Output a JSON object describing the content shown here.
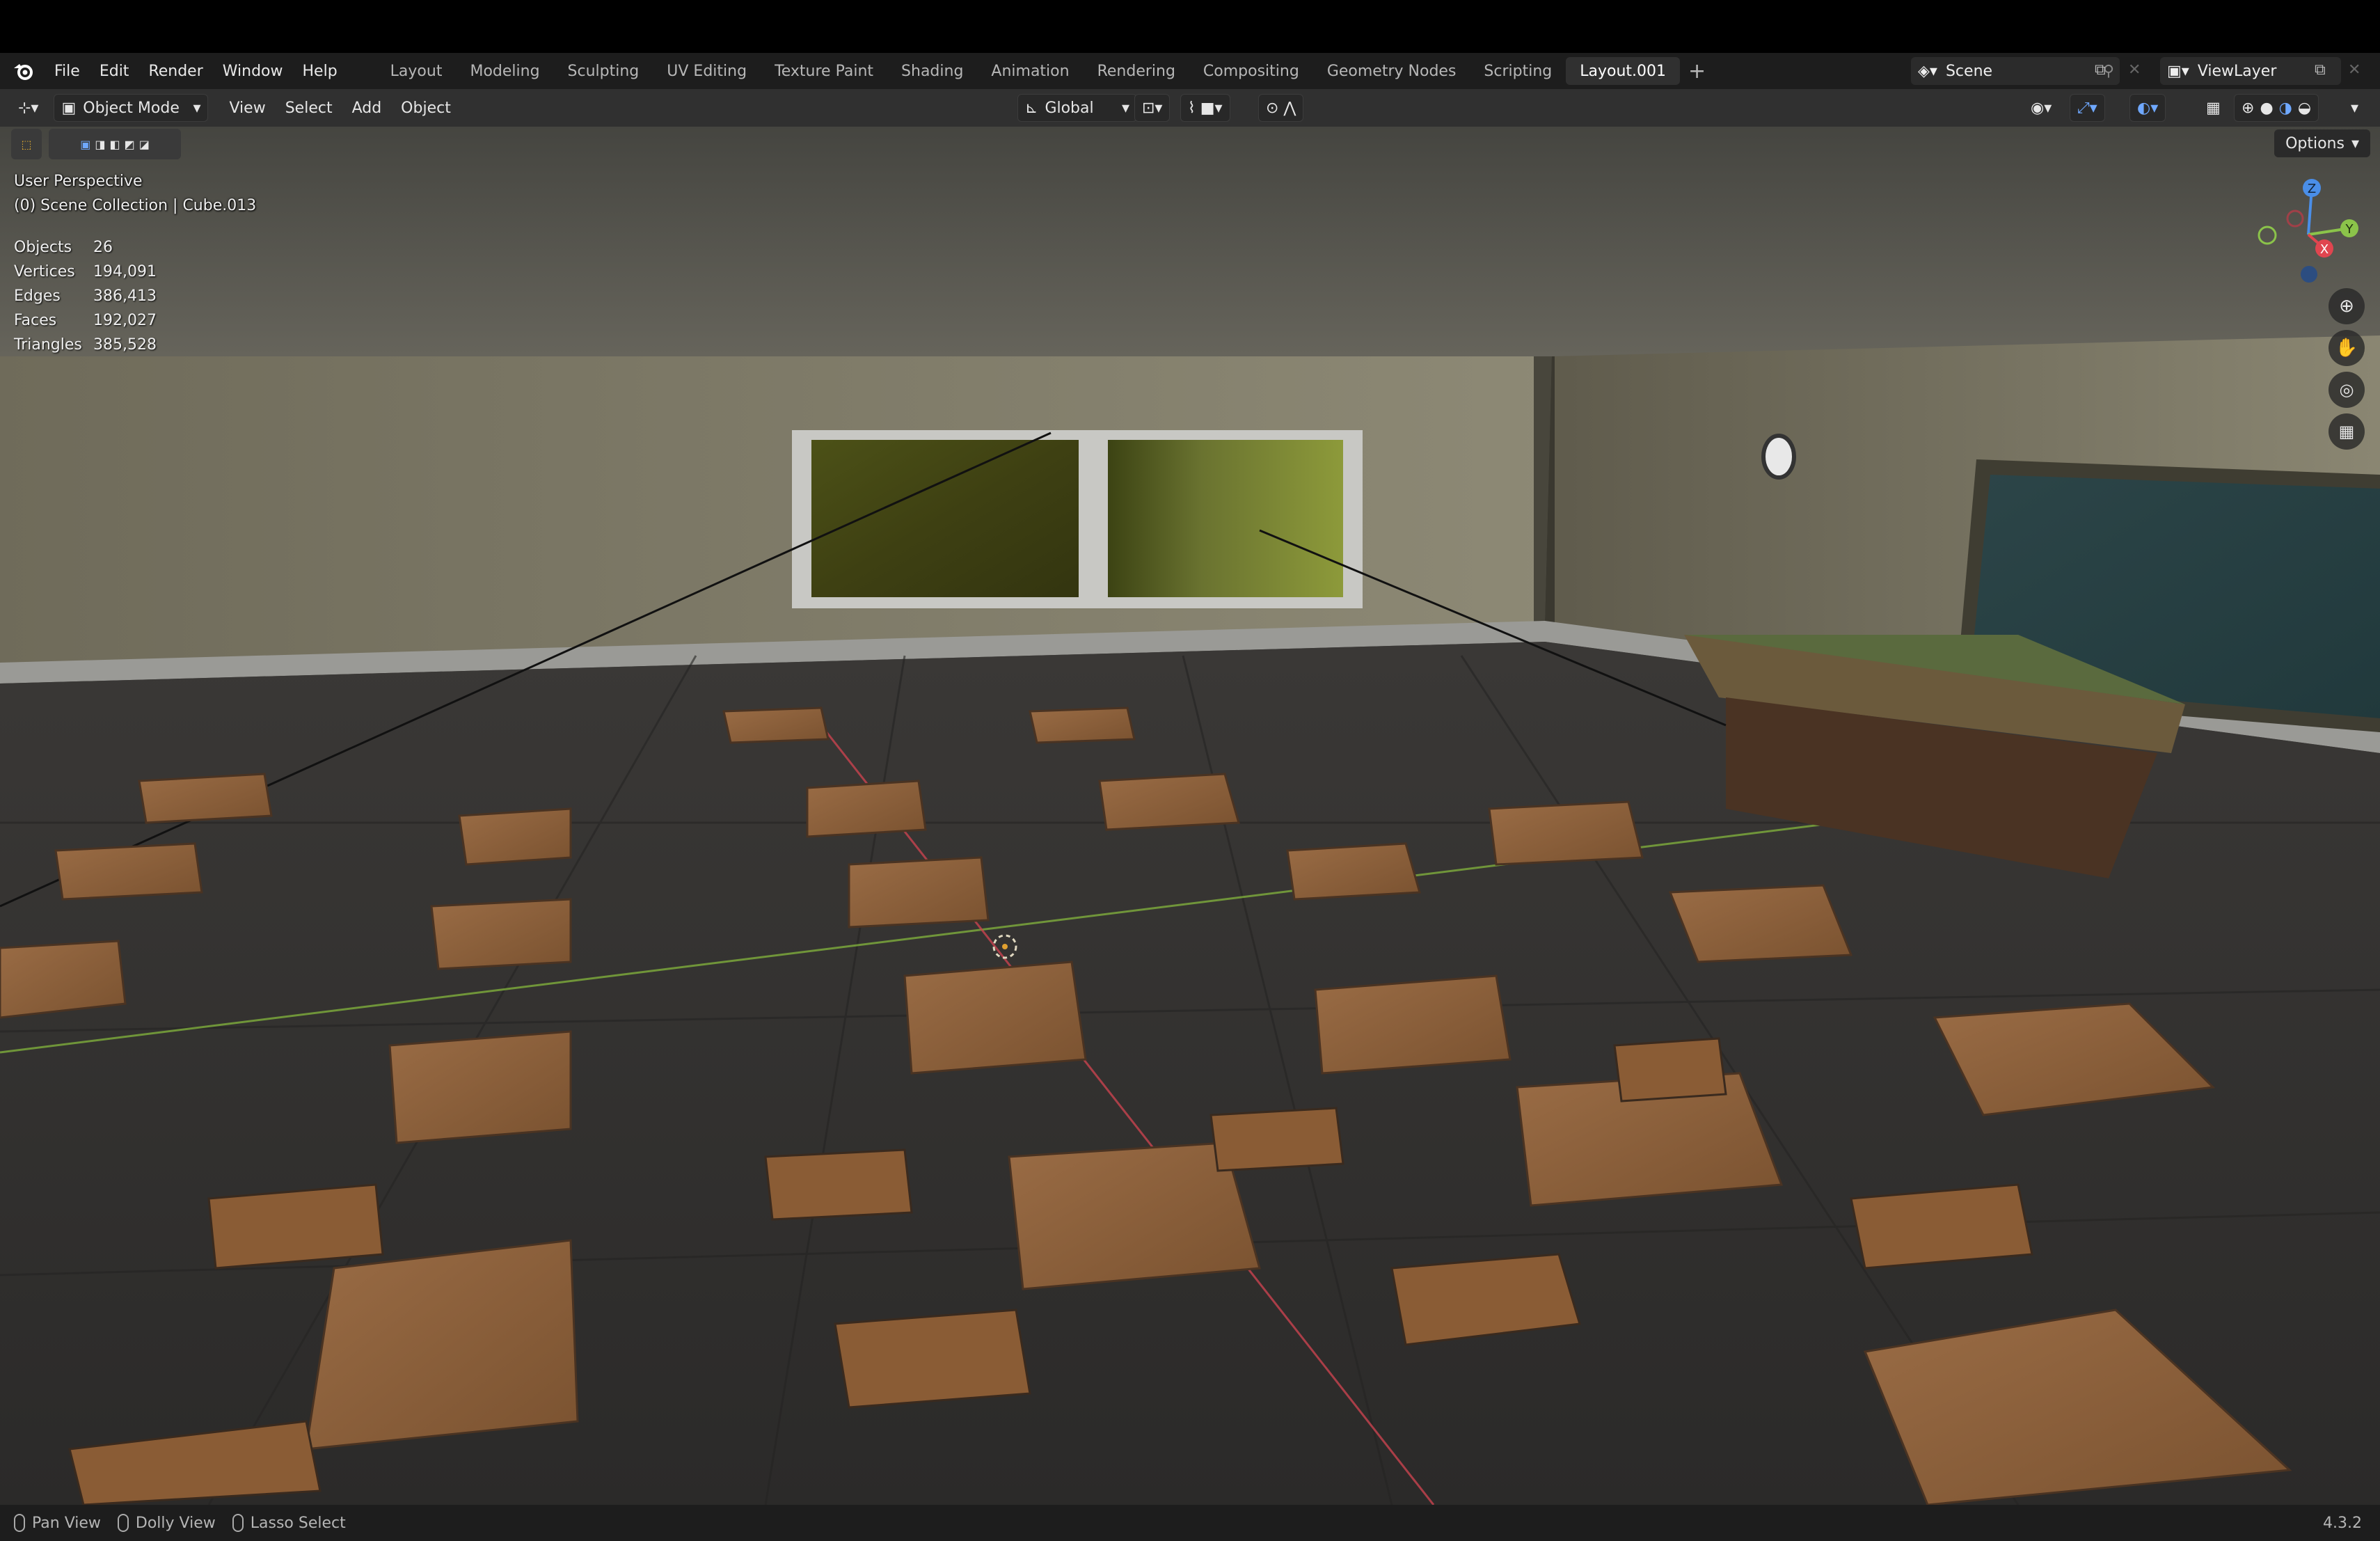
{
  "app": {
    "menu": [
      "File",
      "Edit",
      "Render",
      "Window",
      "Help"
    ],
    "workspaces": [
      "Layout",
      "Modeling",
      "Sculpting",
      "UV Editing",
      "Texture Paint",
      "Shading",
      "Animation",
      "Rendering",
      "Compositing",
      "Geometry Nodes",
      "Scripting",
      "Layout.001"
    ],
    "active_workspace": "Layout.001",
    "scene_name": "Scene",
    "view_layer": "ViewLayer"
  },
  "header": {
    "mode": "Object Mode",
    "menus": [
      "View",
      "Select",
      "Add",
      "Object"
    ],
    "transform_orientation": "Global",
    "options_label": "Options"
  },
  "viewport": {
    "perspective": "User Perspective",
    "collection": "(0) Scene Collection | Cube.013",
    "stats": [
      {
        "label": "Objects",
        "value": "26"
      },
      {
        "label": "Vertices",
        "value": "194,091"
      },
      {
        "label": "Edges",
        "value": "386,413"
      },
      {
        "label": "Faces",
        "value": "192,027"
      },
      {
        "label": "Triangles",
        "value": "385,528"
      }
    ],
    "gizmo_axes": [
      "Z",
      "Y",
      "X"
    ]
  },
  "statusbar": {
    "items": [
      "Pan View",
      "Dolly View",
      "Lasso Select"
    ],
    "version": "4.3.2"
  },
  "colors": {
    "accent_tab": "#303030",
    "x_axis": "#e0454f",
    "y_axis": "#8bc34a",
    "z_axis": "#4a8ee8"
  }
}
